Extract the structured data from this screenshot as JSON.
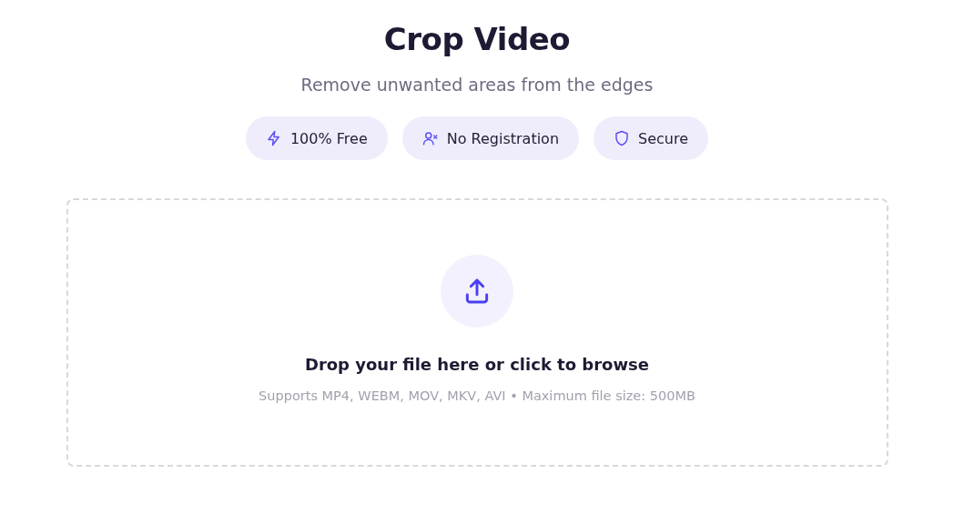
{
  "title": "Crop Video",
  "subtitle": "Remove unwanted areas from the edges",
  "badges": [
    {
      "kind": "bolt",
      "label": "100% Free"
    },
    {
      "kind": "user-x",
      "label": "No Registration"
    },
    {
      "kind": "shield",
      "label": "Secure"
    }
  ],
  "dropzone": {
    "prompt": "Drop your file here or click to browse",
    "hint": "Supports MP4, WEBM, MOV, MKV, AVI • Maximum file size: 500MB"
  }
}
